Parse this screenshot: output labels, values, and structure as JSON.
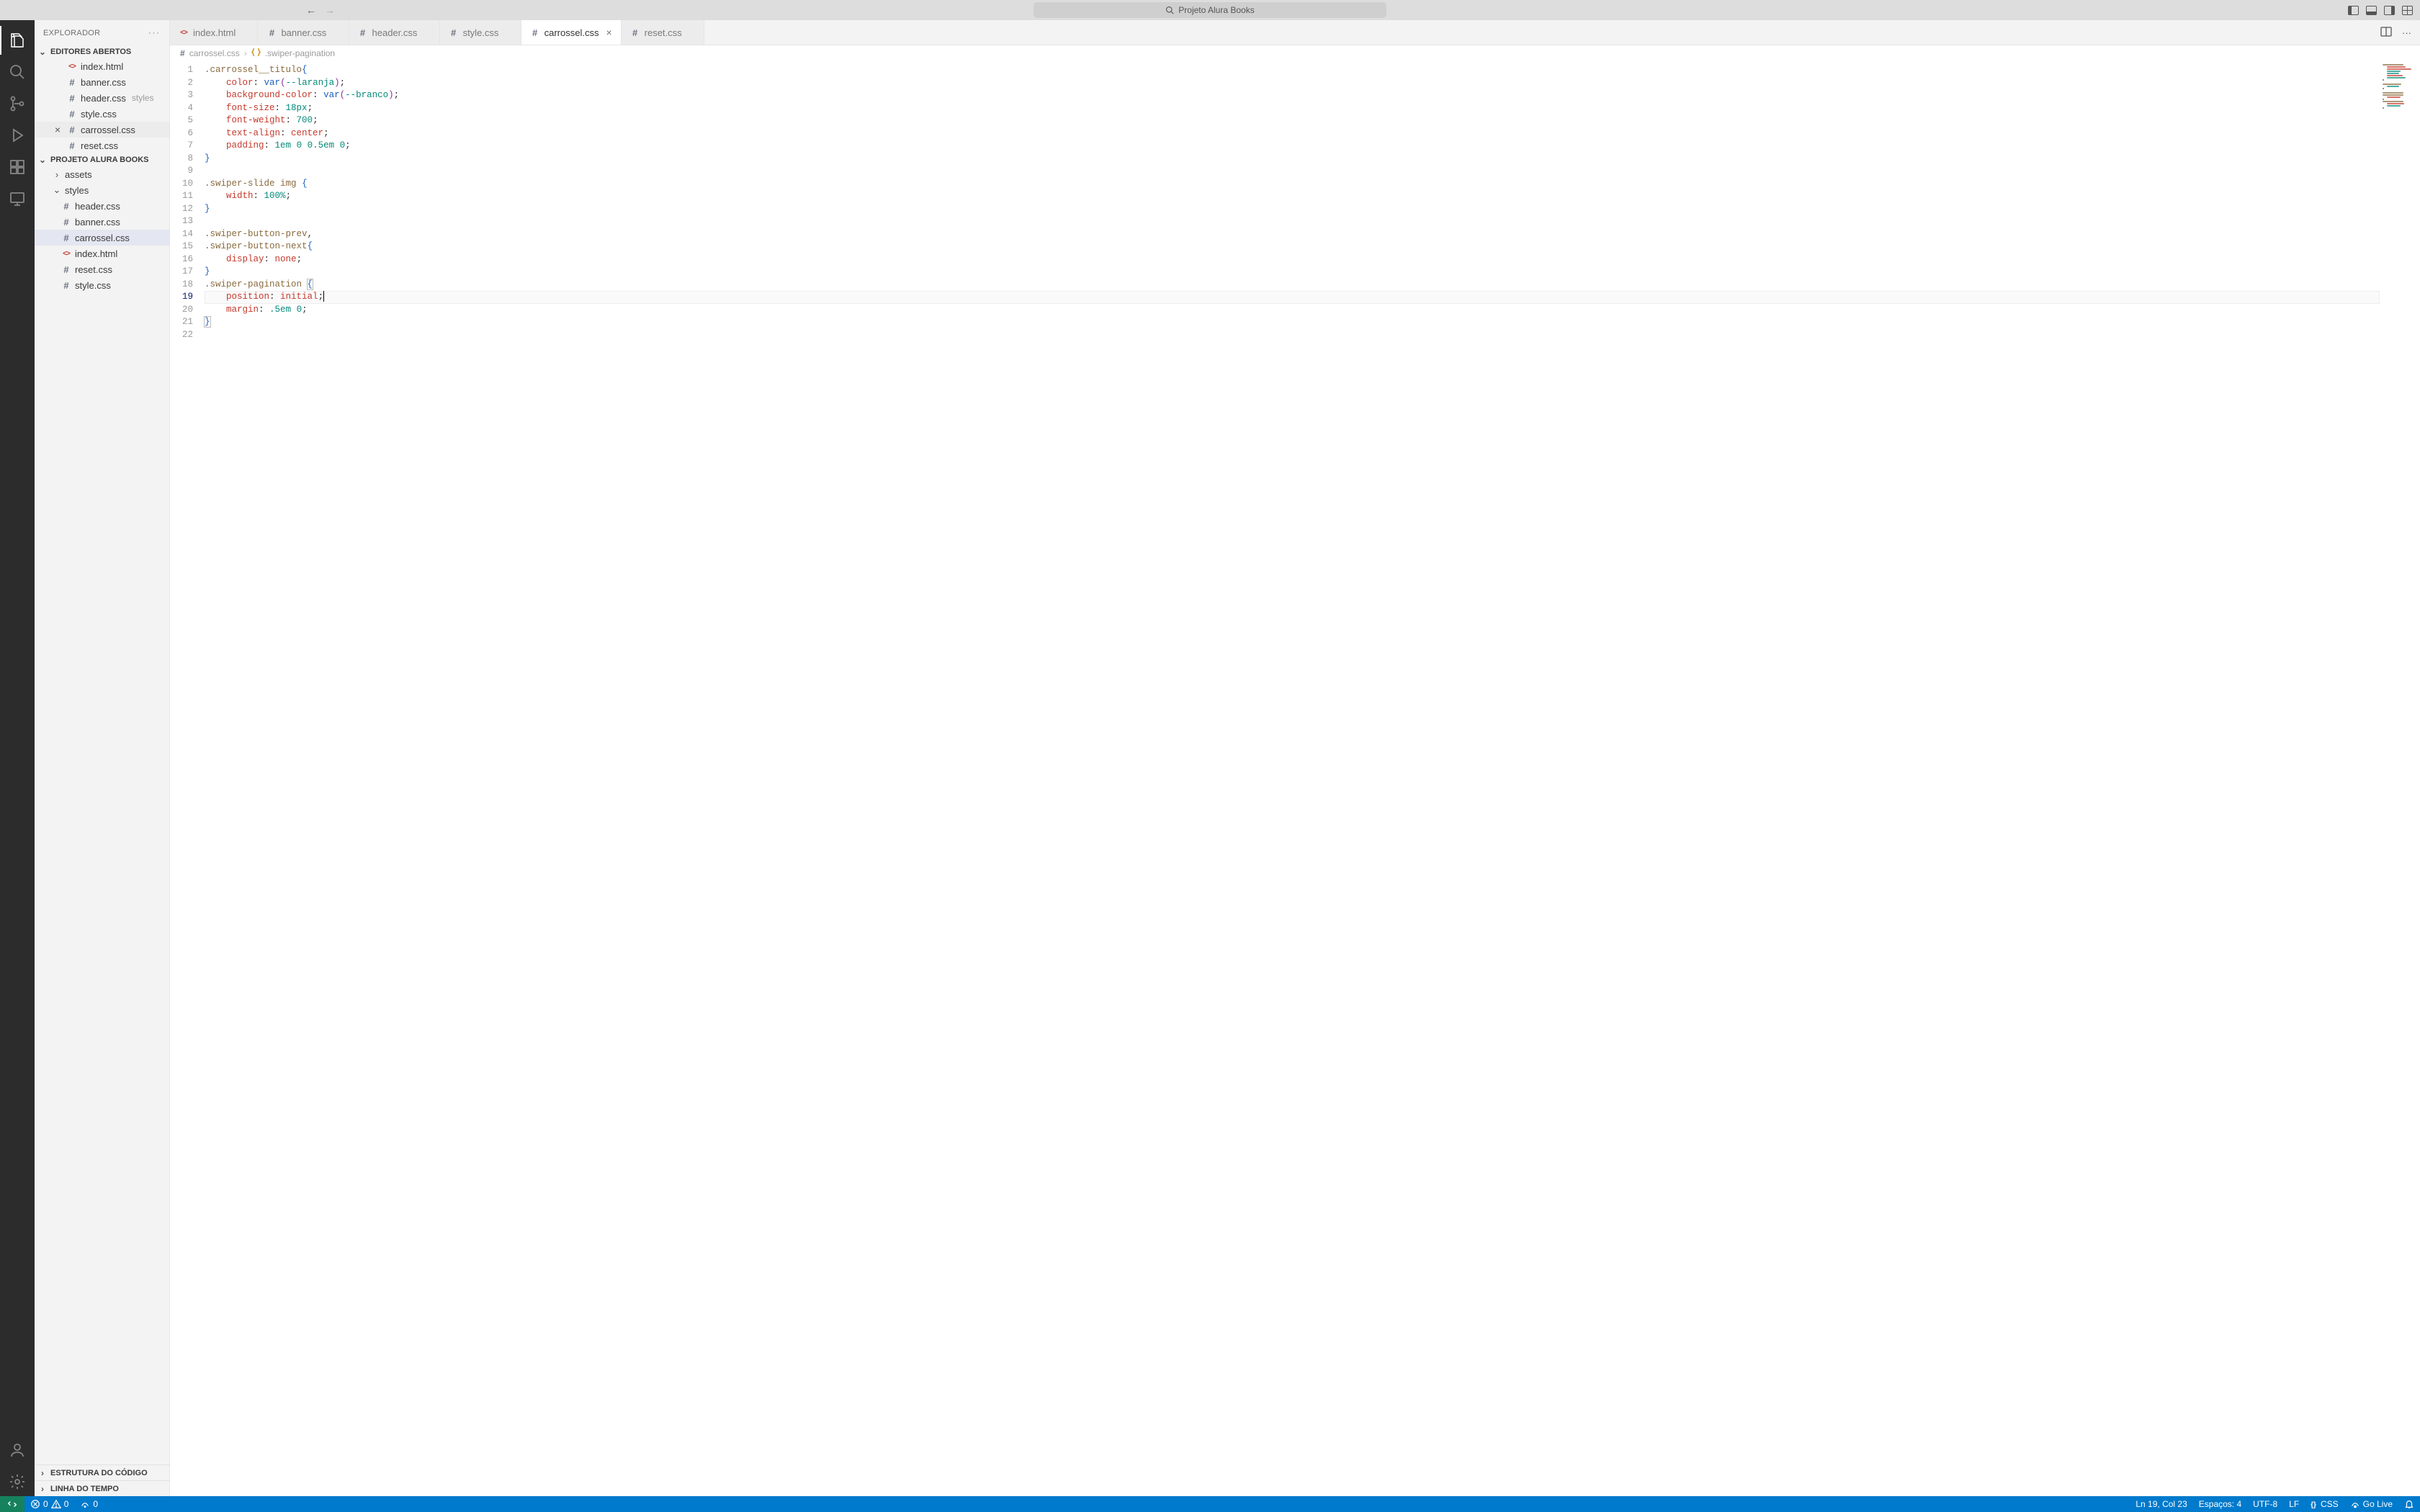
{
  "titlebar": {
    "search_placeholder": "Projeto Alura Books"
  },
  "sidebar": {
    "title": "EXPLORADOR",
    "open_editors_label": "EDITORES ABERTOS",
    "open_editors": [
      {
        "name": "index.html",
        "type": "html"
      },
      {
        "name": "banner.css",
        "type": "css"
      },
      {
        "name": "header.css",
        "type": "css",
        "desc": "styles"
      },
      {
        "name": "style.css",
        "type": "css"
      },
      {
        "name": "carrossel.css",
        "type": "css",
        "active": true
      },
      {
        "name": "reset.css",
        "type": "css"
      }
    ],
    "project_label": "PROJETO ALURA BOOKS",
    "project_tree": {
      "folders": [
        {
          "name": "assets",
          "expanded": false
        },
        {
          "name": "styles",
          "expanded": true,
          "children": [
            {
              "name": "header.css",
              "type": "css"
            },
            {
              "name": "banner.css",
              "type": "css"
            },
            {
              "name": "carrossel.css",
              "type": "css",
              "selected": true
            },
            {
              "name": "index.html",
              "type": "html"
            },
            {
              "name": "reset.css",
              "type": "css"
            },
            {
              "name": "style.css",
              "type": "css"
            }
          ]
        }
      ]
    },
    "outline_label": "ESTRUTURA DO CÓDIGO",
    "timeline_label": "LINHA DO TEMPO"
  },
  "tabs": [
    {
      "name": "index.html",
      "type": "html"
    },
    {
      "name": "banner.css",
      "type": "css"
    },
    {
      "name": "header.css",
      "type": "css"
    },
    {
      "name": "style.css",
      "type": "css"
    },
    {
      "name": "carrossel.css",
      "type": "css",
      "active": true
    },
    {
      "name": "reset.css",
      "type": "css"
    }
  ],
  "breadcrumbs": {
    "file": "carrossel.css",
    "symbol": ".swiper-pagination"
  },
  "code": {
    "lines": [
      {
        "n": 1,
        "tokens": [
          [
            "sel",
            ".carrossel__titulo"
          ],
          [
            "bracket1",
            "{"
          ]
        ]
      },
      {
        "n": 2,
        "indent": 1,
        "tokens": [
          [
            "prop",
            "color"
          ],
          [
            "pn",
            ": "
          ],
          [
            "func",
            "var"
          ],
          [
            "bracket2",
            "("
          ],
          [
            "varname",
            "--laranja"
          ],
          [
            "bracket2",
            ")"
          ],
          [
            "pn",
            ";"
          ]
        ]
      },
      {
        "n": 3,
        "indent": 1,
        "tokens": [
          [
            "prop",
            "background-color"
          ],
          [
            "pn",
            ": "
          ],
          [
            "func",
            "var"
          ],
          [
            "bracket2",
            "("
          ],
          [
            "varname",
            "--branco"
          ],
          [
            "bracket2",
            ")"
          ],
          [
            "pn",
            ";"
          ]
        ]
      },
      {
        "n": 4,
        "indent": 1,
        "tokens": [
          [
            "prop",
            "font-size"
          ],
          [
            "pn",
            ": "
          ],
          [
            "num",
            "18px"
          ],
          [
            "pn",
            ";"
          ]
        ]
      },
      {
        "n": 5,
        "indent": 1,
        "tokens": [
          [
            "prop",
            "font-weight"
          ],
          [
            "pn",
            ": "
          ],
          [
            "num",
            "700"
          ],
          [
            "pn",
            ";"
          ]
        ]
      },
      {
        "n": 6,
        "indent": 1,
        "tokens": [
          [
            "prop",
            "text-align"
          ],
          [
            "pn",
            ": "
          ],
          [
            "id",
            "center"
          ],
          [
            "pn",
            ";"
          ]
        ]
      },
      {
        "n": 7,
        "indent": 1,
        "tokens": [
          [
            "prop",
            "padding"
          ],
          [
            "pn",
            ": "
          ],
          [
            "num",
            "1em"
          ],
          [
            "pn",
            " "
          ],
          [
            "num",
            "0"
          ],
          [
            "pn",
            " "
          ],
          [
            "num",
            "0.5em"
          ],
          [
            "pn",
            " "
          ],
          [
            "num",
            "0"
          ],
          [
            "pn",
            ";"
          ]
        ]
      },
      {
        "n": 8,
        "tokens": [
          [
            "bracket1",
            "}"
          ]
        ]
      },
      {
        "n": 9,
        "tokens": []
      },
      {
        "n": 10,
        "tokens": [
          [
            "sel",
            ".swiper-slide"
          ],
          [
            "pn",
            " "
          ],
          [
            "sel",
            "img"
          ],
          [
            "pn",
            " "
          ],
          [
            "bracket1",
            "{"
          ]
        ]
      },
      {
        "n": 11,
        "indent": 1,
        "tokens": [
          [
            "prop",
            "width"
          ],
          [
            "pn",
            ": "
          ],
          [
            "num",
            "100%"
          ],
          [
            "pn",
            ";"
          ]
        ]
      },
      {
        "n": 12,
        "tokens": [
          [
            "bracket1",
            "}"
          ]
        ]
      },
      {
        "n": 13,
        "tokens": []
      },
      {
        "n": 14,
        "tokens": [
          [
            "sel",
            ".swiper-button-prev"
          ],
          [
            "pn",
            ","
          ]
        ]
      },
      {
        "n": 15,
        "tokens": [
          [
            "sel",
            ".swiper-button-next"
          ],
          [
            "bracket1",
            "{"
          ]
        ]
      },
      {
        "n": 16,
        "indent": 1,
        "tokens": [
          [
            "prop",
            "display"
          ],
          [
            "pn",
            ": "
          ],
          [
            "id",
            "none"
          ],
          [
            "pn",
            ";"
          ]
        ]
      },
      {
        "n": 17,
        "tokens": [
          [
            "bracket1",
            "}"
          ]
        ]
      },
      {
        "n": 18,
        "tokens": [
          [
            "sel",
            ".swiper-pagination"
          ],
          [
            "pn",
            " "
          ],
          [
            "bracket1 bracket-box",
            "{"
          ]
        ]
      },
      {
        "n": 19,
        "indent": 1,
        "active": true,
        "tokens": [
          [
            "prop",
            "position"
          ],
          [
            "pn",
            ": "
          ],
          [
            "id",
            "initial"
          ],
          [
            "pn",
            ";"
          ]
        ],
        "cursor_after": true
      },
      {
        "n": 20,
        "indent": 1,
        "tokens": [
          [
            "prop",
            "margin"
          ],
          [
            "pn",
            ": "
          ],
          [
            "num",
            ".5em"
          ],
          [
            "pn",
            " "
          ],
          [
            "num",
            "0"
          ],
          [
            "pn",
            ";"
          ]
        ]
      },
      {
        "n": 21,
        "tokens": [
          [
            "bracket1 bracket-box",
            "}"
          ]
        ]
      },
      {
        "n": 22,
        "tokens": []
      }
    ]
  },
  "statusbar": {
    "errors": "0",
    "warnings": "0",
    "ports": "0",
    "cursor": "Ln 19, Col 23",
    "spaces": "Espaços: 4",
    "encoding": "UTF-8",
    "eol": "LF",
    "lang": "CSS",
    "golive": "Go Live"
  }
}
